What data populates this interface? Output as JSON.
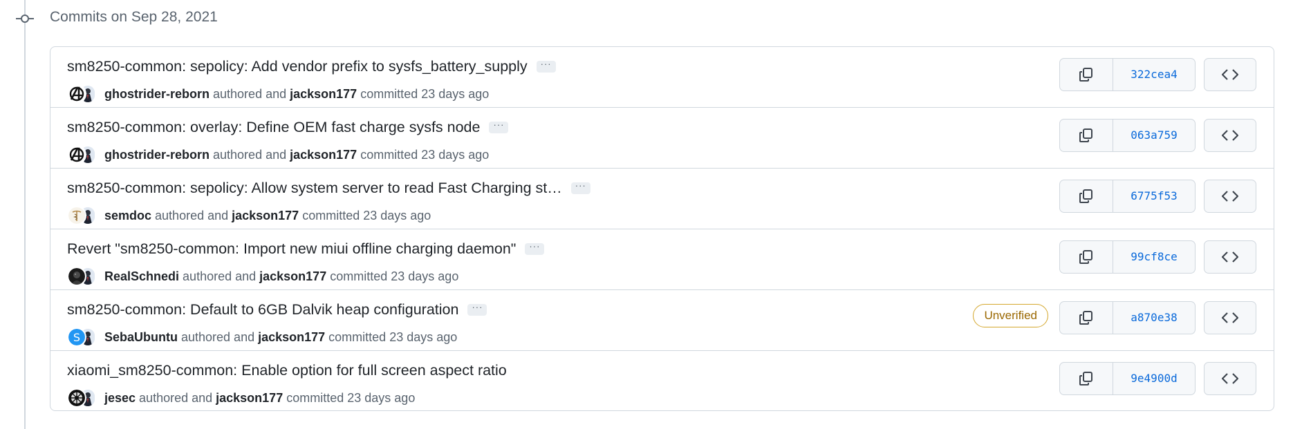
{
  "group": {
    "title": "Commits on Sep 28, 2021"
  },
  "labels": {
    "more": "···",
    "authored_and": "authored and",
    "committed": "committed",
    "unverified": "Unverified"
  },
  "colors": {
    "border": "#d0d7de",
    "sha_link": "#0969da",
    "unverified_border": "#d4a72c",
    "unverified_text": "#9a6700",
    "muted_text": "#59636e"
  },
  "commits": [
    {
      "message": "sm8250-common: sepolicy: Add vendor prefix to sysfs_battery_supply",
      "author": "ghostrider-reborn",
      "committer": "jackson177",
      "time": "23 days ago",
      "sha": "322cea4",
      "author_avatar_icon": "avengers-logo-icon"
    },
    {
      "message": "sm8250-common: overlay: Define OEM fast charge sysfs node",
      "author": "ghostrider-reborn",
      "committer": "jackson177",
      "time": "23 days ago",
      "sha": "063a759",
      "author_avatar_icon": "avengers-logo-icon"
    },
    {
      "message": "sm8250-common: sepolicy: Allow system server to read Fast Charging st…",
      "author": "semdoc",
      "committer": "jackson177",
      "time": "23 days ago",
      "sha": "6775f53",
      "author_avatar_icon": "caduceus-icon"
    },
    {
      "message": "Revert \"sm8250-common: Import new miui offline charging daemon\"",
      "author": "RealSchnedi",
      "committer": "jackson177",
      "time": "23 days ago",
      "sha": "99cf8ce",
      "author_avatar_icon": "dark-portrait-icon"
    },
    {
      "message": "sm8250-common: Default to 6GB Dalvik heap configuration",
      "author": "SebaUbuntu",
      "committer": "jackson177",
      "time": "23 days ago",
      "sha": "a870e38",
      "author_avatar_icon": "letter-s-avatar-icon",
      "avatar_letter": "S",
      "unverified": true
    },
    {
      "message": "xiaomi_sm8250-common: Enable option for full screen aspect ratio",
      "author": "jesec",
      "committer": "jackson177",
      "time": "23 days ago",
      "sha": "9e4900d",
      "author_avatar_icon": "wheel-icon"
    }
  ]
}
